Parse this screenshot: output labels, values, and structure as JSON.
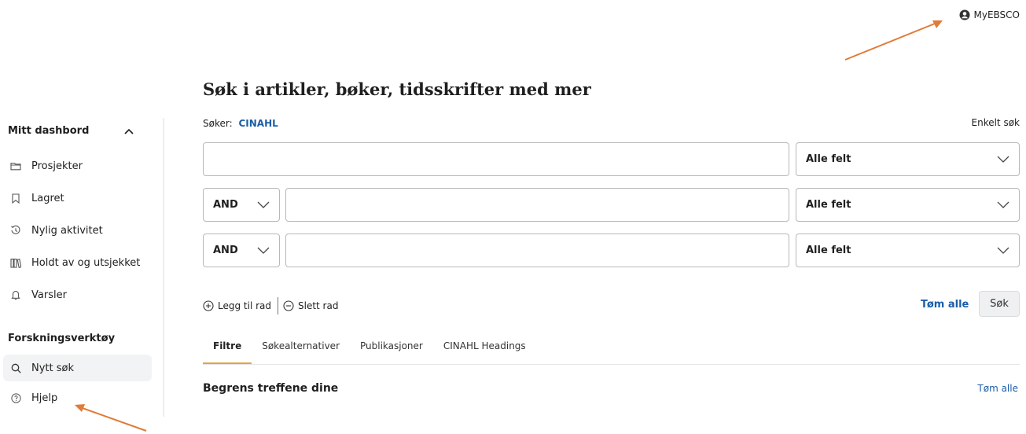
{
  "header": {
    "account_label": "MyEBSCO"
  },
  "sidebar": {
    "dashboard_title": "Mitt dashbord",
    "items": [
      {
        "label": "Prosjekter",
        "icon": "folder-icon"
      },
      {
        "label": "Lagret",
        "icon": "bookmark-icon"
      },
      {
        "label": "Nylig aktivitet",
        "icon": "history-icon"
      },
      {
        "label": "Holdt av og utsjekket",
        "icon": "books-icon"
      },
      {
        "label": "Varsler",
        "icon": "bell-icon"
      }
    ],
    "tools_title": "Forskningsverktøy",
    "tools": [
      {
        "label": "Nytt søk",
        "icon": "search-icon"
      },
      {
        "label": "Hjelp",
        "icon": "help-icon"
      }
    ]
  },
  "main": {
    "title": "Søk i artikler, bøker, tidsskrifter med mer",
    "searching_label": "Søker:",
    "database": "CINAHL",
    "simple_search": "Enkelt søk",
    "rows": [
      {
        "query": "",
        "field": "Alle felt"
      },
      {
        "operator": "AND",
        "query": "",
        "field": "Alle felt"
      },
      {
        "operator": "AND",
        "query": "",
        "field": "Alle felt"
      }
    ],
    "add_row": "Legg til rad",
    "delete_row": "Slett rad",
    "clear_all": "Tøm alle",
    "search_button": "Søk",
    "tabs": [
      {
        "label": "Filtre",
        "active": true
      },
      {
        "label": "Søkealternativer",
        "active": false
      },
      {
        "label": "Publikasjoner",
        "active": false
      },
      {
        "label": "CINAHL Headings",
        "active": false
      }
    ],
    "refine_title": "Begrens treffene dine",
    "refine_clear": "Tøm alle"
  },
  "colors": {
    "link": "#1b5ea8",
    "tab_accent": "#e5a43b",
    "annotation_arrow": "#e07b39"
  }
}
